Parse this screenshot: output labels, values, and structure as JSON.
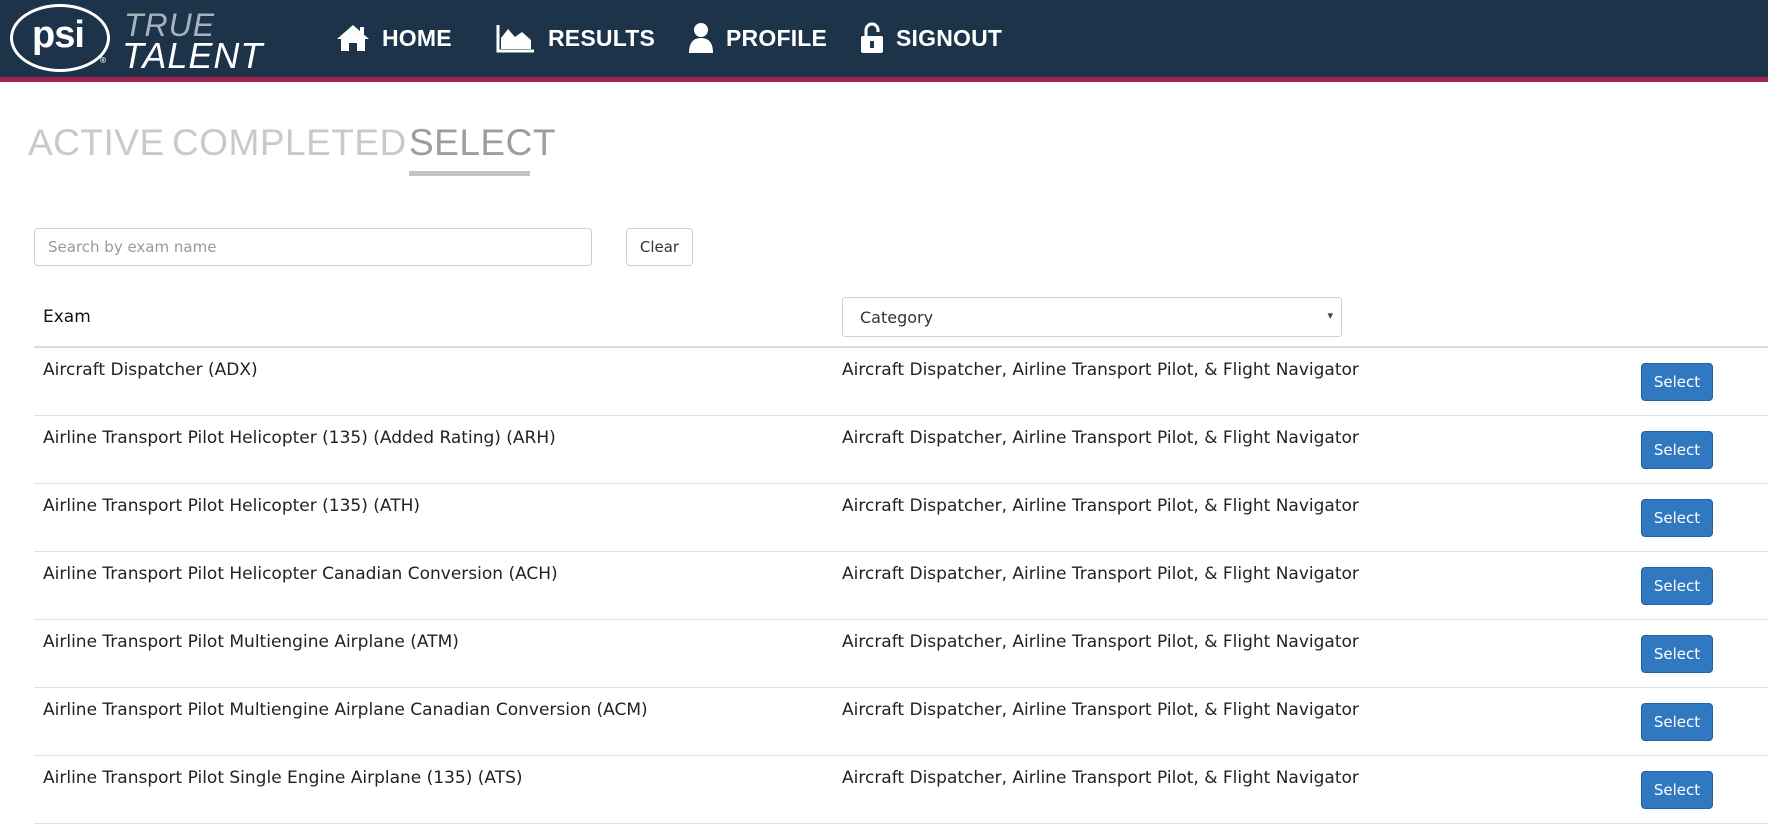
{
  "brand": {
    "logo_text": "psi",
    "logo_mark": "®",
    "line1": "TRUE",
    "line2": "TALENT"
  },
  "nav": [
    {
      "label": "HOME",
      "icon": "home-icon"
    },
    {
      "label": "RESULTS",
      "icon": "chart-icon"
    },
    {
      "label": "PROFILE",
      "icon": "user-icon"
    },
    {
      "label": "SIGNOUT",
      "icon": "unlock-icon"
    }
  ],
  "tabs": [
    {
      "label": "ACTIVE",
      "selected": false
    },
    {
      "label": "COMPLETED",
      "selected": false
    },
    {
      "label": "SELECT",
      "selected": true
    }
  ],
  "search": {
    "placeholder": "Search by exam name",
    "value": "",
    "clear_label": "Clear"
  },
  "table": {
    "exam_header": "Exam",
    "category_filter": {
      "selected": "Category",
      "arrow": "▾"
    },
    "button_label": "Select",
    "rows": [
      {
        "exam": "Aircraft Dispatcher (ADX)",
        "category": "Aircraft Dispatcher, Airline Transport Pilot, & Flight Navigator"
      },
      {
        "exam": "Airline Transport Pilot Helicopter (135) (Added Rating) (ARH)",
        "category": "Aircraft Dispatcher, Airline Transport Pilot, & Flight Navigator"
      },
      {
        "exam": "Airline Transport Pilot Helicopter (135) (ATH)",
        "category": "Aircraft Dispatcher, Airline Transport Pilot, & Flight Navigator"
      },
      {
        "exam": "Airline Transport Pilot Helicopter Canadian Conversion (ACH)",
        "category": "Aircraft Dispatcher, Airline Transport Pilot, & Flight Navigator"
      },
      {
        "exam": "Airline Transport Pilot Multiengine Airplane (ATM)",
        "category": "Aircraft Dispatcher, Airline Transport Pilot, & Flight Navigator"
      },
      {
        "exam": "Airline Transport Pilot Multiengine Airplane Canadian Conversion (ACM)",
        "category": "Aircraft Dispatcher, Airline Transport Pilot, & Flight Navigator"
      },
      {
        "exam": "Airline Transport Pilot Single Engine Airplane (135) (ATS)",
        "category": "Aircraft Dispatcher, Airline Transport Pilot, & Flight Navigator"
      }
    ]
  },
  "colors": {
    "nav_background": "#1c3349",
    "nav_accent": "#a3224f",
    "button_blue": "#3079c1",
    "tab_inactive": "#c9c9c9",
    "tab_selected": "#9d9d9d"
  }
}
